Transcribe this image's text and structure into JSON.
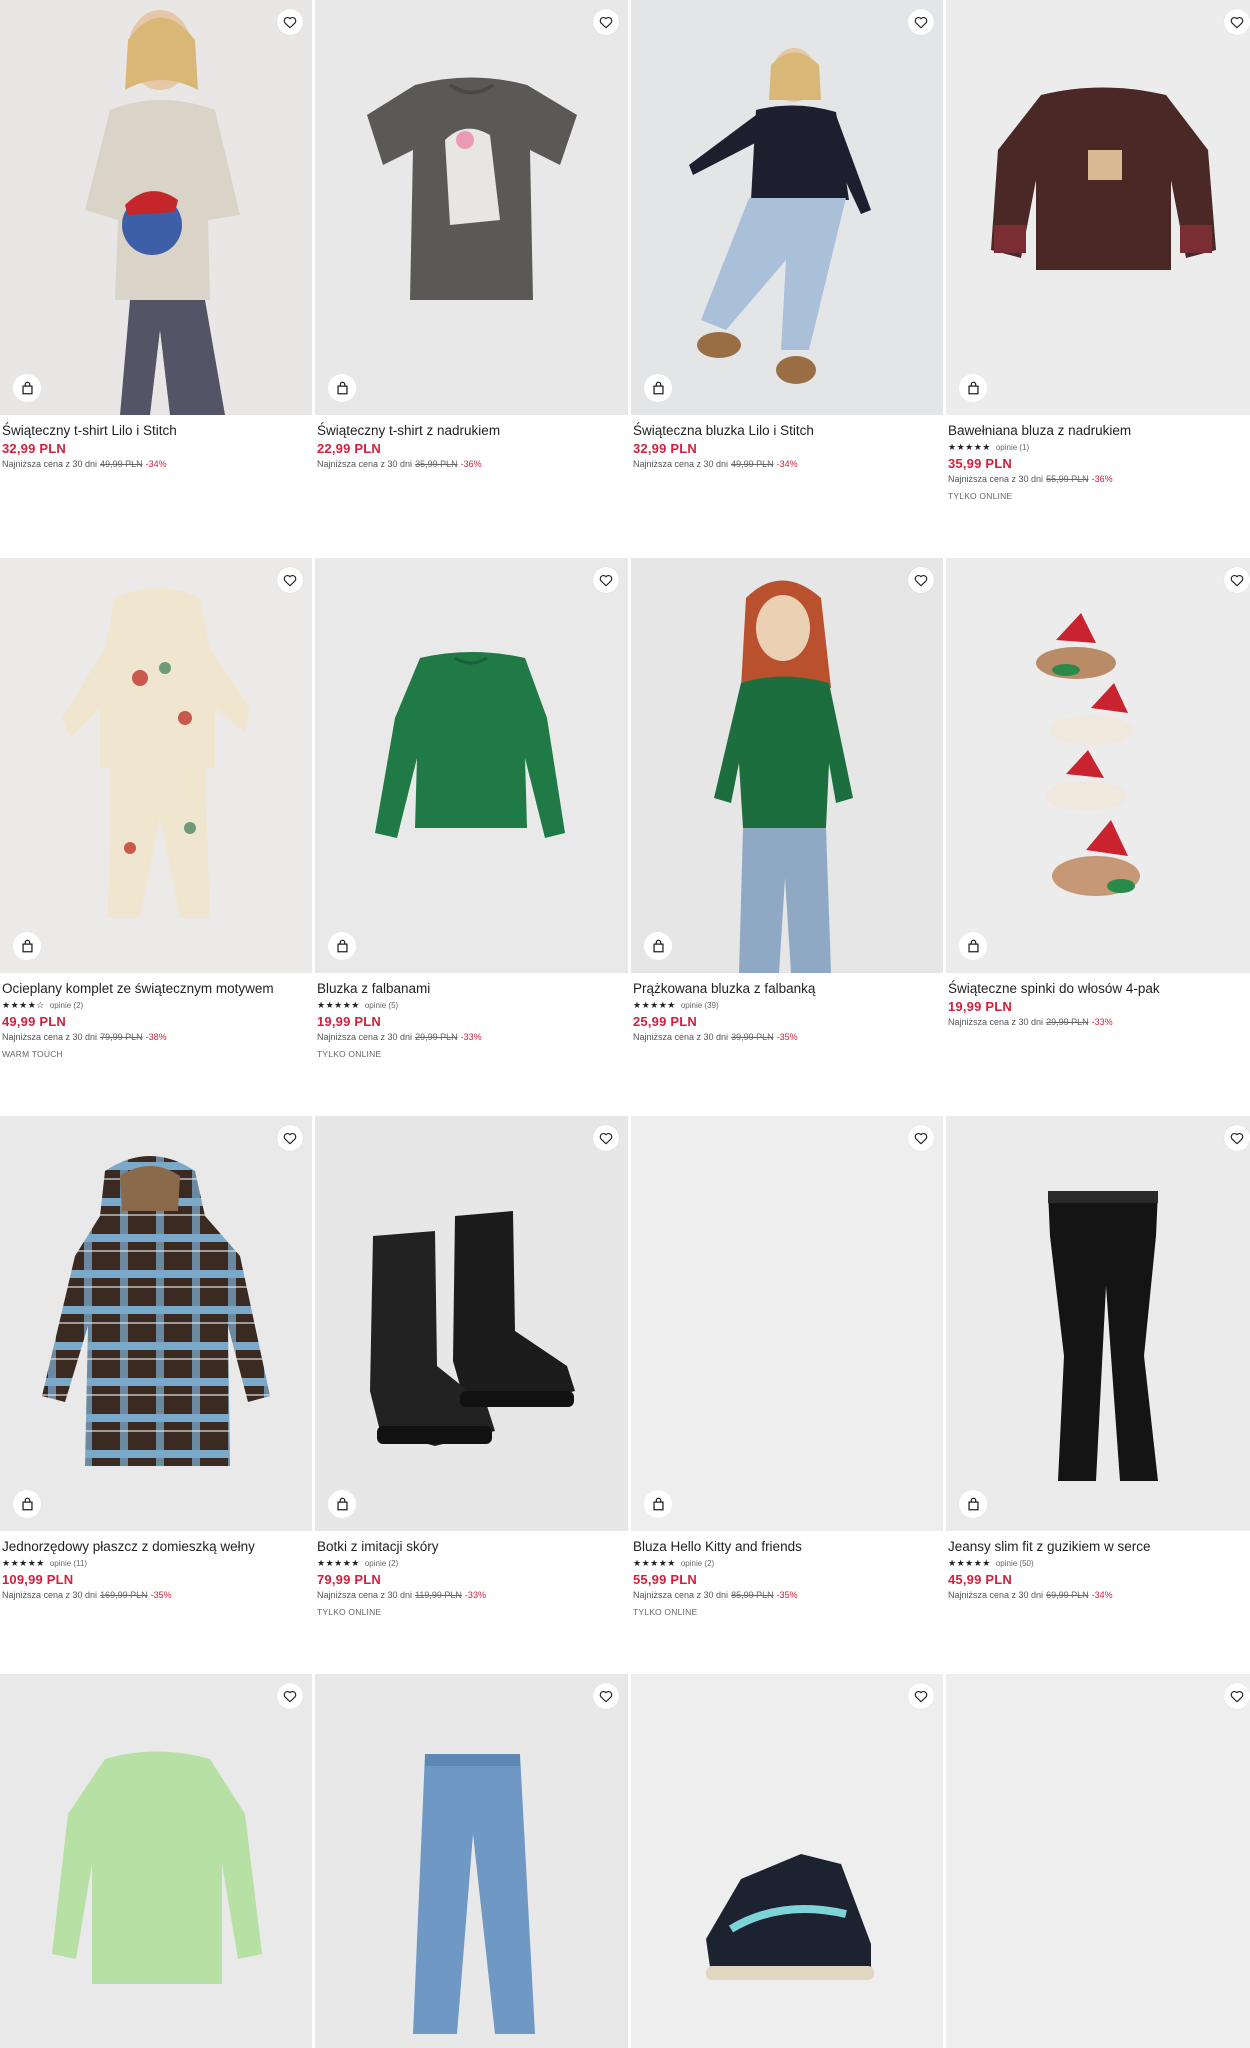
{
  "colors": {
    "price": "#d1213c",
    "image_bg": "#e9e9e9",
    "text": "#222222"
  },
  "icons": {
    "wishlist": "heart-outline-icon",
    "bag": "shopping-bag-icon",
    "star": "star-icon"
  },
  "products": [
    {
      "name": "Świąteczny t-shirt Lilo i Stitch",
      "stars": "",
      "reviews": "",
      "price": "32,99 PLN",
      "lowest_label": "Najniższa cena z 30 dni",
      "old_price": "49,99 PLN",
      "discount": "-34%",
      "badge": ""
    },
    {
      "name": "Świąteczny t-shirt z nadrukiem",
      "stars": "",
      "reviews": "",
      "price": "22,99 PLN",
      "lowest_label": "Najniższa cena z 30 dni",
      "old_price": "35,99 PLN",
      "discount": "-36%",
      "badge": ""
    },
    {
      "name": "Świąteczna bluzka Lilo i Stitch",
      "stars": "",
      "reviews": "",
      "price": "32,99 PLN",
      "lowest_label": "Najniższa cena z 30 dni",
      "old_price": "49,99 PLN",
      "discount": "-34%",
      "badge": ""
    },
    {
      "name": "Bawełniana bluza z nadrukiem",
      "stars": "★★★★★",
      "reviews": "opinie (1)",
      "price": "35,99 PLN",
      "lowest_label": "Najniższa cena z 30 dni",
      "old_price": "55,99 PLN",
      "discount": "-36%",
      "badge": "TYLKO ONLINE"
    },
    {
      "name": "Ocieplany komplet ze świątecznym motywem",
      "stars": "★★★★☆",
      "reviews": "opinie (2)",
      "price": "49,99 PLN",
      "lowest_label": "Najniższa cena z 30 dni",
      "old_price": "79,99 PLN",
      "discount": "-38%",
      "badge": "WARM TOUCH"
    },
    {
      "name": "Bluzka z falbanami",
      "stars": "★★★★★",
      "reviews": "opinie (5)",
      "price": "19,99 PLN",
      "lowest_label": "Najniższa cena z 30 dni",
      "old_price": "29,99 PLN",
      "discount": "-33%",
      "badge": "TYLKO ONLINE"
    },
    {
      "name": "Prążkowana bluzka z falbanką",
      "stars": "★★★★★",
      "reviews": "opinie (39)",
      "price": "25,99 PLN",
      "lowest_label": "Najniższa cena z 30 dni",
      "old_price": "39,99 PLN",
      "discount": "-35%",
      "badge": ""
    },
    {
      "name": "Świąteczne spinki do włosów 4-pak",
      "stars": "",
      "reviews": "",
      "price": "19,99 PLN",
      "lowest_label": "Najniższa cena z 30 dni",
      "old_price": "29,99 PLN",
      "discount": "-33%",
      "badge": ""
    },
    {
      "name": "Jednorzędowy płaszcz z domieszką wełny",
      "stars": "★★★★★",
      "reviews": "opinie (11)",
      "price": "109,99 PLN",
      "lowest_label": "Najniższa cena z 30 dni",
      "old_price": "169,99 PLN",
      "discount": "-35%",
      "badge": ""
    },
    {
      "name": "Botki z imitacji skóry",
      "stars": "★★★★★",
      "reviews": "opinie (2)",
      "price": "79,99 PLN",
      "lowest_label": "Najniższa cena z 30 dni",
      "old_price": "119,99 PLN",
      "discount": "-33%",
      "badge": "TYLKO ONLINE"
    },
    {
      "name": "Bluza Hello Kitty and friends",
      "stars": "★★★★★",
      "reviews": "opinie (2)",
      "price": "55,99 PLN",
      "lowest_label": "Najniższa cena z 30 dni",
      "old_price": "85,99 PLN",
      "discount": "-35%",
      "badge": "TYLKO ONLINE"
    },
    {
      "name": "Jeansy slim fit z guzikiem w serce",
      "stars": "★★★★★",
      "reviews": "opinie (50)",
      "price": "45,99 PLN",
      "lowest_label": "Najniższa cena z 30 dni",
      "old_price": "69,99 PLN",
      "discount": "-34%",
      "badge": ""
    },
    {
      "name": "",
      "stars": "",
      "reviews": "",
      "price": "",
      "lowest_label": "",
      "old_price": "",
      "discount": "",
      "badge": ""
    },
    {
      "name": "",
      "stars": "",
      "reviews": "",
      "price": "",
      "lowest_label": "",
      "old_price": "",
      "discount": "",
      "badge": ""
    },
    {
      "name": "",
      "stars": "",
      "reviews": "",
      "price": "",
      "lowest_label": "",
      "old_price": "",
      "discount": "",
      "badge": ""
    },
    {
      "name": "",
      "stars": "",
      "reviews": "",
      "price": "",
      "lowest_label": "",
      "old_price": "",
      "discount": "",
      "badge": ""
    }
  ]
}
